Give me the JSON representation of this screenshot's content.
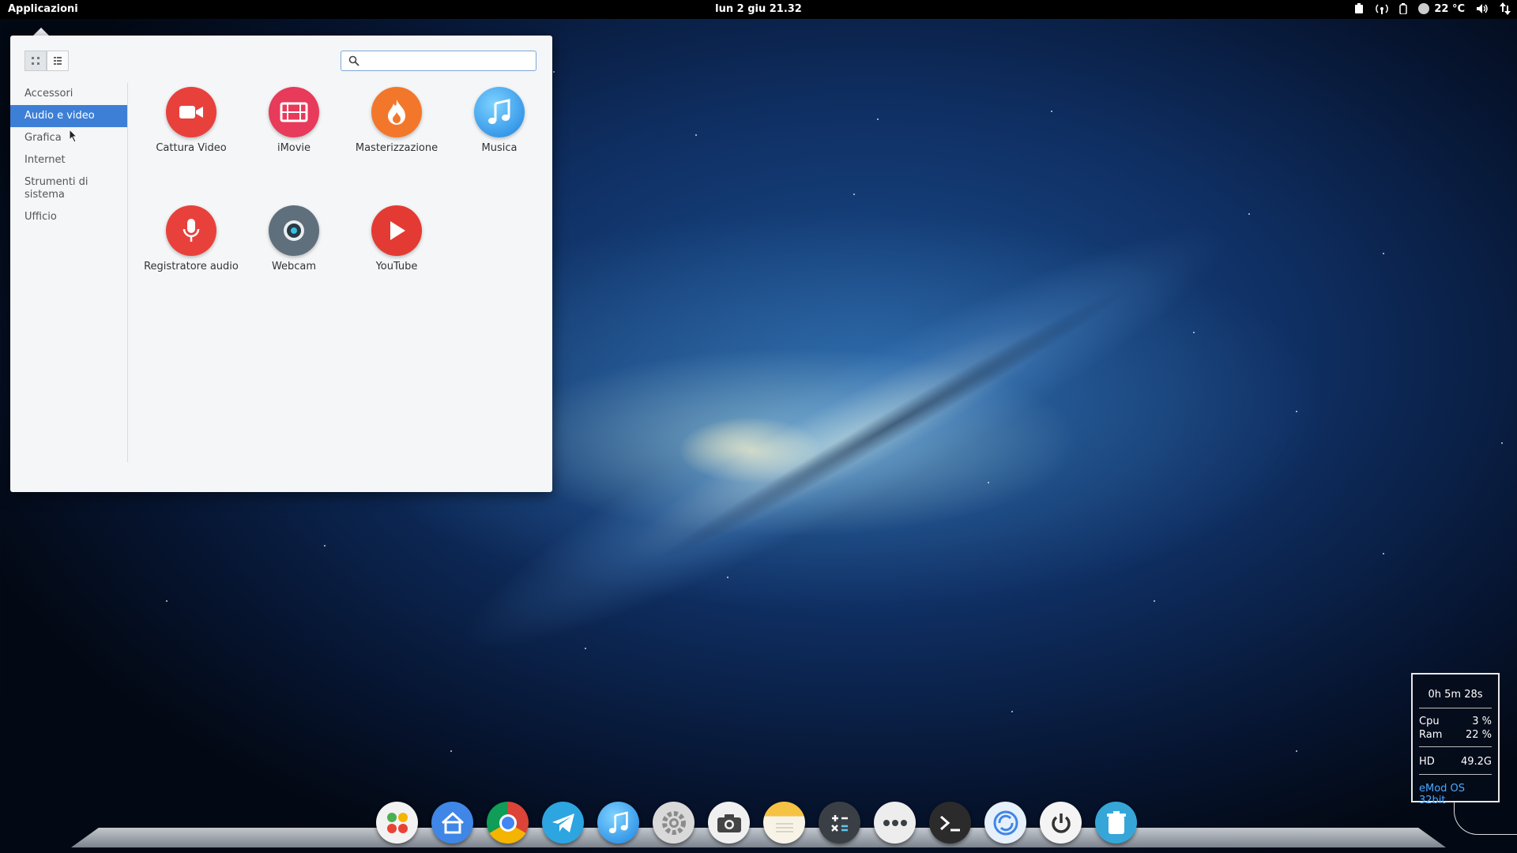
{
  "top_panel": {
    "menu_label": "Applicazioni",
    "clock": "lun  2 giu 21.32",
    "temperature": "22 °C",
    "tray_icons": [
      "clipboard-icon",
      "wireless-icon",
      "battery-icon",
      "weather-icon",
      "volume-icon",
      "network-icon"
    ]
  },
  "app_menu": {
    "view_buttons": [
      "grid-view-icon",
      "list-view-icon"
    ],
    "search": {
      "value": "",
      "placeholder": ""
    },
    "categories": [
      "Accessori",
      "Audio e video",
      "Grafica",
      "Internet",
      "Strumenti di sistema",
      "Ufficio"
    ],
    "selected_category": "Audio e video",
    "apps": [
      {
        "label": "Cattura Video",
        "icon": "video-camera-icon",
        "color": "#e8413c"
      },
      {
        "label": "iMovie",
        "icon": "film-icon",
        "color": "#e83a5a"
      },
      {
        "label": "Masterizzazione",
        "icon": "flame-icon",
        "color": "#f2772b"
      },
      {
        "label": "Musica",
        "icon": "music-note-icon",
        "color": "#2b9cef"
      },
      {
        "label": "Registratore audio",
        "icon": "microphone-icon",
        "color": "#e8413c"
      },
      {
        "label": "Webcam",
        "icon": "webcam-icon",
        "color": "#5f6f7c"
      },
      {
        "label": "YouTube",
        "icon": "play-icon",
        "color": "#e33b33"
      }
    ]
  },
  "conky": {
    "uptime": "0h 5m 28s",
    "cpu_label": "Cpu",
    "cpu_value": "3  %",
    "ram_label": "Ram",
    "ram_value": "22 %",
    "hd_label": "HD",
    "hd_value": "49.2G",
    "brand": "eMod OS 32bit"
  },
  "dock": {
    "items": [
      {
        "name": "launcher-icon",
        "color": "#f2f2f2"
      },
      {
        "name": "home-icon",
        "color": "#3f86e6"
      },
      {
        "name": "chrome-icon",
        "color": "#ffffff"
      },
      {
        "name": "telegram-icon",
        "color": "#2ca5e0"
      },
      {
        "name": "itunes-icon",
        "color": "#2b9cef"
      },
      {
        "name": "settings-icon",
        "color": "#d9d9d9"
      },
      {
        "name": "camera-icon",
        "color": "#f0f0f0"
      },
      {
        "name": "notes-icon",
        "color": "#f7f3e6"
      },
      {
        "name": "calculator-icon",
        "color": "#3a3f45"
      },
      {
        "name": "more-icon",
        "color": "#ededed"
      },
      {
        "name": "terminal-icon",
        "color": "#2b2b2b"
      },
      {
        "name": "sync-icon",
        "color": "#e6f0fb"
      },
      {
        "name": "power-icon",
        "color": "#f4f4f4"
      },
      {
        "name": "trash-icon",
        "color": "#36a6d9"
      }
    ]
  }
}
